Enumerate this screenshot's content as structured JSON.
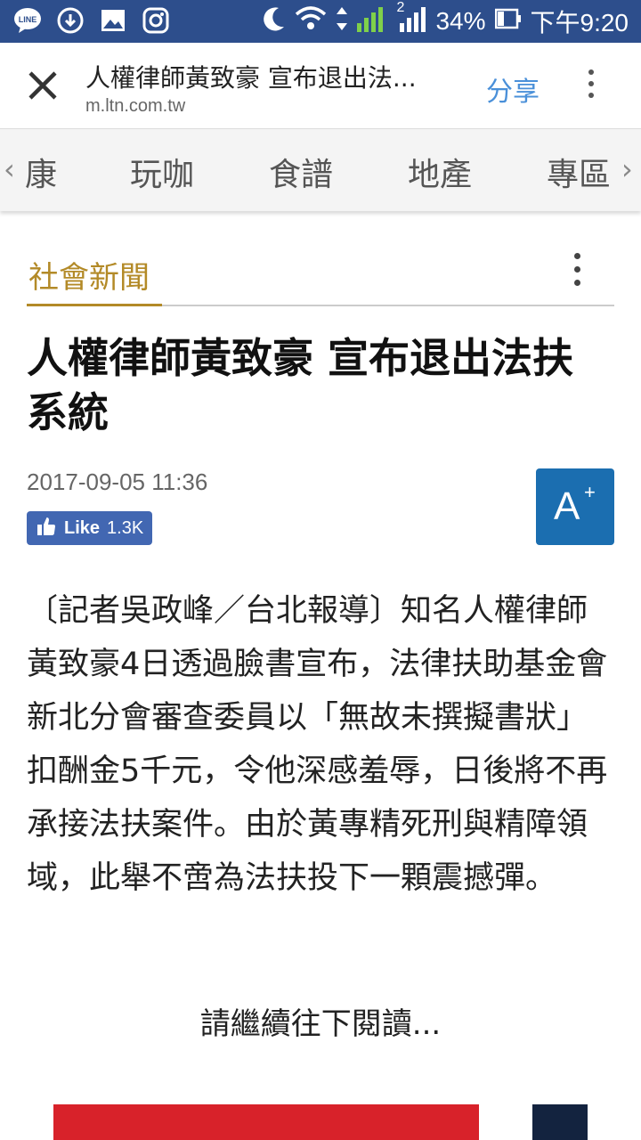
{
  "status_bar": {
    "battery": "34%",
    "time": "下午9:20",
    "sim_slot": "2"
  },
  "app_bar": {
    "title": "人權律師黃致豪 宣布退出法...",
    "url": "m.ltn.com.tw",
    "share_label": "分享"
  },
  "categories": [
    "康",
    "玩咖",
    "食譜",
    "地產",
    "專區"
  ],
  "section": {
    "label": "社會新聞"
  },
  "article": {
    "headline": "人權律師黃致豪 宣布退出法扶系統",
    "date": "2017-09-05 11:36",
    "like_label": "Like",
    "like_count": "1.3K",
    "font_button_label": "A",
    "font_button_sup": "+",
    "body": "〔記者吳政峰／台北報導〕知名人權律師黃致豪4日透過臉書宣布，法律扶助基金會新北分會審查委員以「無故未撰擬書狀」扣酬金5千元，令他深感羞辱，日後將不再承接法扶案件。由於黃專精死刑與精障領域，此舉不啻為法扶投下一顆震撼彈。",
    "continue_reading": "請繼續往下閱讀..."
  },
  "colors": {
    "status_bar": "#2d4e8c",
    "section_accent": "#b38a27",
    "font_button": "#1b6eb0",
    "like_button": "#4267b2",
    "share": "#4a90d9"
  }
}
